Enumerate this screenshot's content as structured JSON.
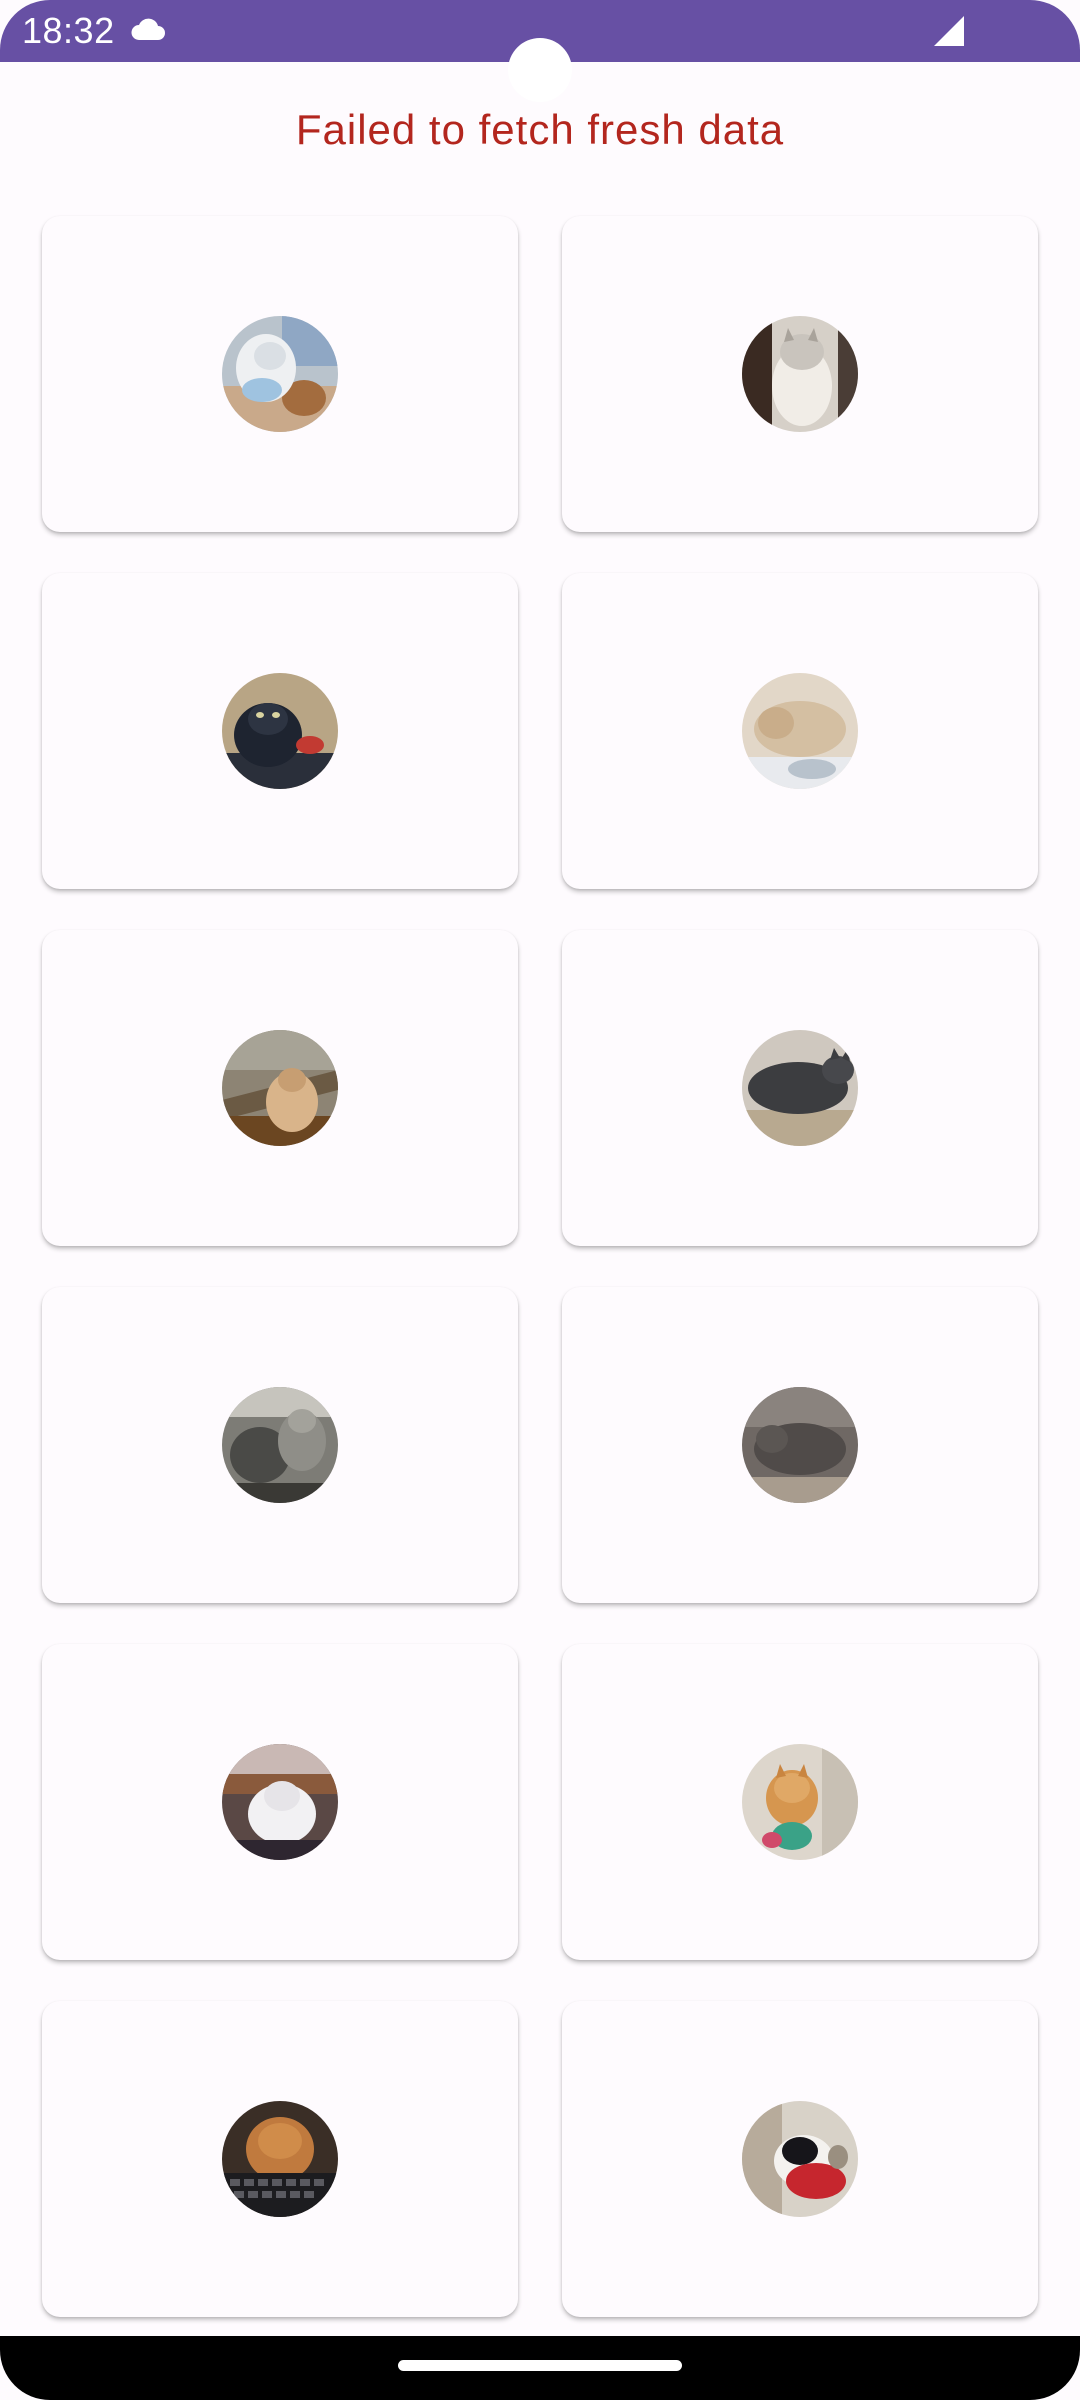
{
  "status_bar": {
    "time": "18:32",
    "background_color": "#6750a4",
    "icons": [
      "cloud-icon",
      "cellular-signal-icon"
    ]
  },
  "error": {
    "message": "Failed to fetch fresh data",
    "color": "#b3261e"
  },
  "cats": [
    {
      "photo": "white-cat-on-blanket-photo"
    },
    {
      "photo": "grey-white-kitten-sitting-photo"
    },
    {
      "photo": "black-cat-with-red-toy-photo"
    },
    {
      "photo": "cream-cat-lying-photo"
    },
    {
      "photo": "tabby-cat-on-chair-photo"
    },
    {
      "photo": "grey-cat-lying-photo"
    },
    {
      "photo": "two-tabby-kittens-photo"
    },
    {
      "photo": "grey-cat-sleeping-photo"
    },
    {
      "photo": "white-fluffy-cat-photo"
    },
    {
      "photo": "ginger-kitten-photo"
    },
    {
      "photo": "fluffy-cat-on-keyboard-photo"
    },
    {
      "photo": "black-white-cat-in-red-photo"
    }
  ],
  "nav_bar": {
    "icons": [
      "home-gesture-handle"
    ]
  }
}
